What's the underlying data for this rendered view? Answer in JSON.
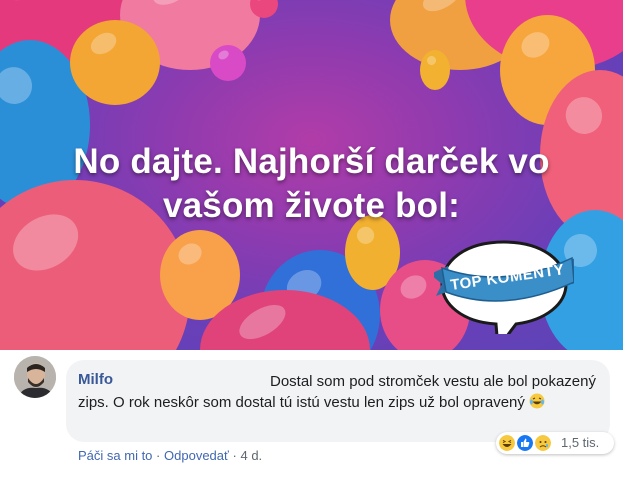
{
  "banner": {
    "headline_line1": "No dajte. Najhorší darček vo",
    "headline_line2": "vašom živote bol:",
    "badge_text": "TOP KOMENTY"
  },
  "comment": {
    "author": "Milfo",
    "text": "Dostal som pod stromček vestu ale bol pokazený zips. O rok neskôr som dostal tú istú vestu len zips už bol opravený",
    "reactions": [
      "haha-icon",
      "like-icon",
      "sad-icon"
    ],
    "reaction_count": "1,5 tis.",
    "like_label": "Páči sa mi to",
    "separator": "·",
    "reply_label": "Odpovedať",
    "time": "4 d."
  },
  "colors": {
    "author": "#385898",
    "link": "#4267b2",
    "bubble_bg": "#f2f3f5",
    "ribbon": "#3b8fc8"
  }
}
